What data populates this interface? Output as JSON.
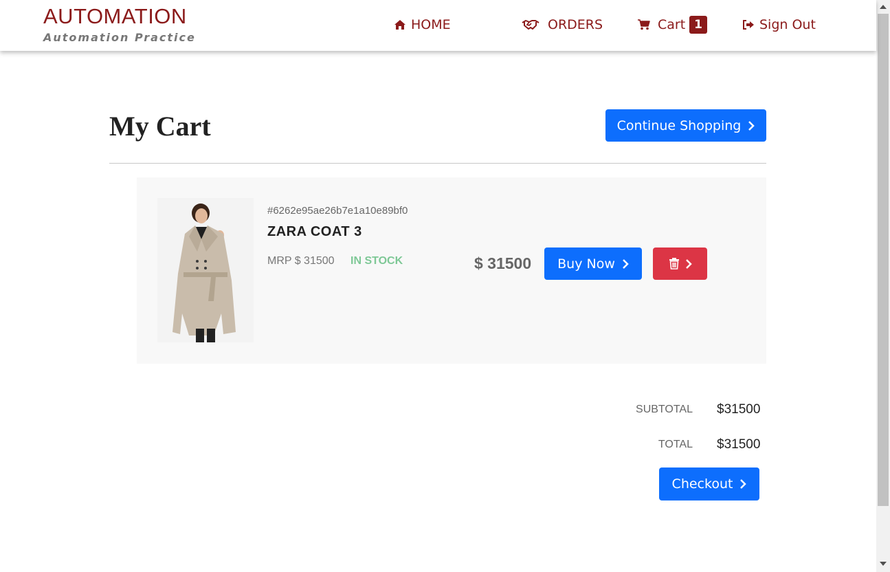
{
  "header": {
    "brand_title": "AUTOMATION",
    "brand_subtitle": "Automation Practice",
    "nav": {
      "home": "HOME",
      "orders": "ORDERS",
      "cart": "Cart",
      "cart_count": "1",
      "sign_out": "Sign Out"
    },
    "icons": {
      "home": "home-icon",
      "orders": "handshake-icon",
      "cart": "cart-icon",
      "sign_out": "sign-out-icon"
    }
  },
  "main": {
    "title": "My Cart",
    "continue_label": "Continue Shopping",
    "items": [
      {
        "id": "#6262e95ae26b7e1a10e89bf0",
        "name": "ZARA COAT 3",
        "mrp": "MRP $ 31500",
        "stock": "IN STOCK",
        "price": "$ 31500",
        "buy_label": "Buy Now"
      }
    ],
    "summary": {
      "subtotal_label": "SUBTOTAL",
      "subtotal_value": "$31500",
      "total_label": "TOTAL",
      "total_value": "$31500"
    },
    "checkout_label": "Checkout"
  },
  "colors": {
    "brand": "#8b1a1a",
    "primary_button": "#0d6efd",
    "danger_button": "#dc3545",
    "in_stock": "#7ec896"
  }
}
